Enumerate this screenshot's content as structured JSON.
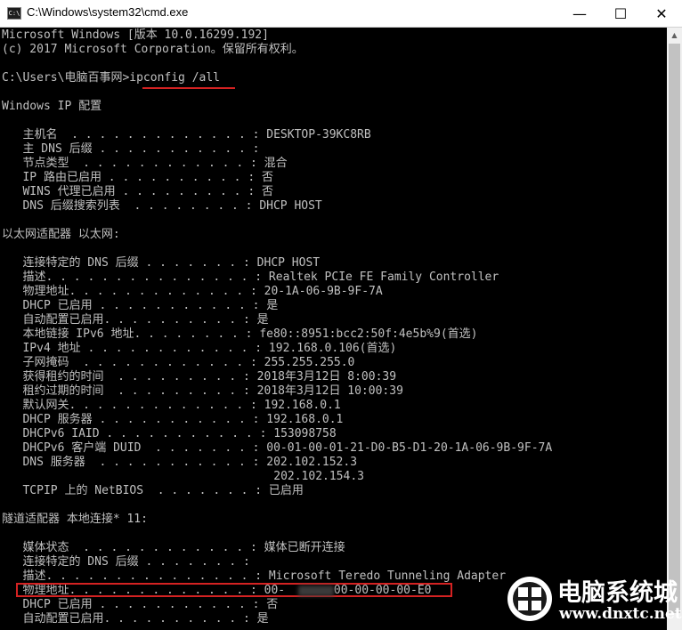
{
  "window": {
    "title": "C:\\Windows\\system32\\cmd.exe",
    "icon_label": "C:\\",
    "minimize_glyph": "—",
    "maximize_glyph": "☐",
    "close_glyph": "✕"
  },
  "console": {
    "lines": [
      "Microsoft Windows [版本 10.0.16299.192]",
      "(c) 2017 Microsoft Corporation。保留所有权利。",
      "",
      "C:\\Users\\电脑百事网>ipconfig /all",
      "",
      "Windows IP 配置",
      "",
      "   主机名  . . . . . . . . . . . . . : DESKTOP-39KC8RB",
      "   主 DNS 后缀 . . . . . . . . . . . :",
      "   节点类型  . . . . . . . . . . . . : 混合",
      "   IP 路由已启用 . . . . . . . . . . : 否",
      "   WINS 代理已启用 . . . . . . . . . : 否",
      "   DNS 后缀搜索列表  . . . . . . . . : DHCP HOST",
      "",
      "以太网适配器 以太网:",
      "",
      "   连接特定的 DNS 后缀 . . . . . . . : DHCP HOST",
      "   描述. . . . . . . . . . . . . . . : Realtek PCIe FE Family Controller",
      "   物理地址. . . . . . . . . . . . . : 20-1A-06-9B-9F-7A",
      "   DHCP 已启用 . . . . . . . . . . . : 是",
      "   自动配置已启用. . . . . . . . . . : 是",
      "   本地链接 IPv6 地址. . . . . . . . : fe80::8951:bcc2:50f:4e5b%9(首选)",
      "   IPv4 地址 . . . . . . . . . . . . : 192.168.0.106(首选)",
      "   子网掩码  . . . . . . . . . . . . : 255.255.255.0",
      "   获得租约的时间  . . . . . . . . . : 2018年3月12日 8:00:39",
      "   租约过期的时间  . . . . . . . . . : 2018年3月12日 10:00:39",
      "   默认网关. . . . . . . . . . . . . : 192.168.0.1",
      "   DHCP 服务器 . . . . . . . . . . . : 192.168.0.1",
      "   DHCPv6 IAID . . . . . . . . . . . : 153098758",
      "   DHCPv6 客户端 DUID  . . . . . . . : 00-01-00-01-21-D0-B5-D1-20-1A-06-9B-9F-7A",
      "   DNS 服务器  . . . . . . . . . . . : 202.102.152.3",
      "                                       202.102.154.3",
      "   TCPIP 上的 NetBIOS  . . . . . . . : 已启用",
      "",
      "隧道适配器 本地连接* 11:",
      "",
      "   媒体状态  . . . . . . . . . . . . : 媒体已断开连接",
      "   连接特定的 DNS 后缀 . . . . . . . :",
      "   描述. . . . . . . . . . . . . . . : Microsoft Teredo Tunneling Adapter",
      "   物理地址. . . . . . . . . . . . . : 00-       00-00-00-00-E0",
      "   DHCP 已启用 . . . . . . . . . . . : 否",
      "   自动配置已启用. . . . . . . . . . : 是"
    ]
  },
  "watermark": {
    "name": "电脑系统城",
    "url": "www.dnxtc.net"
  },
  "colors": {
    "console_bg": "#000000",
    "console_text": "#c0c0c0",
    "highlight": "#d42222",
    "titlebar_bg": "#ffffff"
  }
}
